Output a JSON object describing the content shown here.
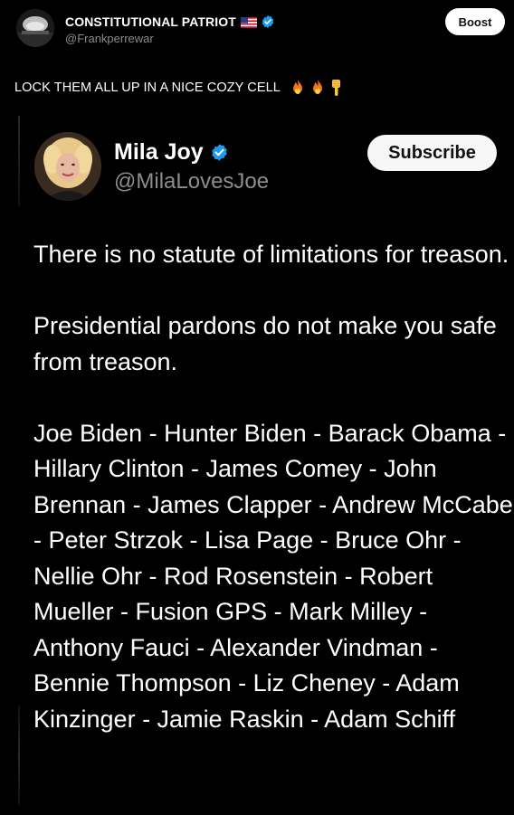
{
  "outer_post": {
    "author_name": "CONSTITUTIONAL PATRIOT",
    "flag_icon": "us-flag-icon",
    "verified_icon": "verified-badge-icon",
    "handle": "@Frankperrewar",
    "boost_label": "Boost",
    "caption": "LOCK THEM ALL UP IN A NICE COZY CELL",
    "caption_emojis": [
      "fire-emoji",
      "fire-emoji",
      "pointing-down-emoji"
    ]
  },
  "quoted_post": {
    "author_name": "Mila Joy",
    "verified_icon": "verified-badge-icon",
    "handle": "@MilaLovesJoe",
    "subscribe_label": "Subscribe",
    "paragraphs": [
      "There is no statute of limitations for treason.",
      "Presidential pardons do not make you safe from treason.",
      "Joe Biden - Hunter Biden - Barack Obama - Hillary Clinton - James Comey - John Brennan - James Clapper - Andrew McCabe - Peter Strzok - Lisa Page - Bruce Ohr - Nellie Ohr - Rod Rosenstein - Robert Mueller - Fusion GPS - Mark Milley - Anthony Fauci - Alexander Vindman - Bennie Thompson - Liz Cheney - Adam Kinzinger - Jamie Raskin - Adam Schiff"
    ]
  },
  "colors": {
    "background": "#000000",
    "text": "#ffffff",
    "muted": "#8b8b8b",
    "verified": "#1d9bf0",
    "button_bg": "#ffffff"
  }
}
